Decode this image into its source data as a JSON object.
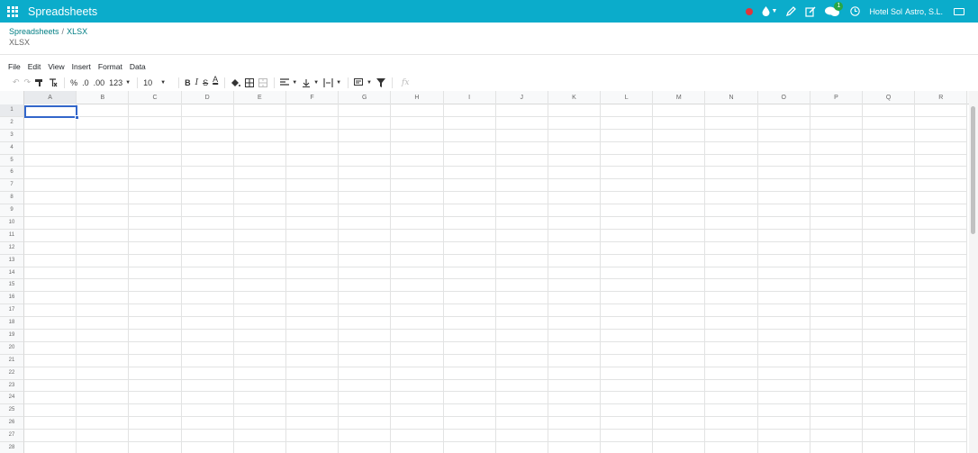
{
  "navbar": {
    "app_name": "Spreadsheets",
    "company": "Hotel Sol",
    "company_suffix": "Astro, S.L.",
    "chat_count": "1",
    "icons": [
      "apps-icon",
      "record-icon",
      "drop-icon",
      "pencil-icon",
      "edit-icon",
      "chat-icon",
      "clock-icon",
      "keyboard-icon"
    ],
    "brand_color": "#0baccb"
  },
  "breadcrumb": {
    "items": [
      "Spreadsheets",
      "XLSX"
    ],
    "separator": "/"
  },
  "document": {
    "title": "XLSX"
  },
  "menu": {
    "items": [
      "File",
      "Edit",
      "View",
      "Insert",
      "Format",
      "Data"
    ]
  },
  "toolbar": {
    "percent": "%",
    "dec_less": ".0",
    "dec_more": ".00",
    "number_format": "123",
    "font_size": "10",
    "bold": "B",
    "italic": "I",
    "strike": "S",
    "text_color": "A",
    "formula_placeholder": "fx"
  },
  "grid": {
    "columns": [
      "A",
      "B",
      "C",
      "D",
      "E",
      "F",
      "G",
      "H",
      "I",
      "J",
      "K",
      "L",
      "M",
      "N",
      "O",
      "P",
      "Q",
      "R"
    ],
    "rows": [
      "1",
      "2",
      "3",
      "4",
      "5",
      "6",
      "7",
      "8",
      "9",
      "10",
      "11",
      "12",
      "13",
      "14",
      "15",
      "16",
      "17",
      "18",
      "19",
      "20",
      "21",
      "22",
      "23",
      "24",
      "25",
      "26",
      "27",
      "28"
    ],
    "selected_cell": "A1",
    "selection_color": "#3266ca"
  }
}
